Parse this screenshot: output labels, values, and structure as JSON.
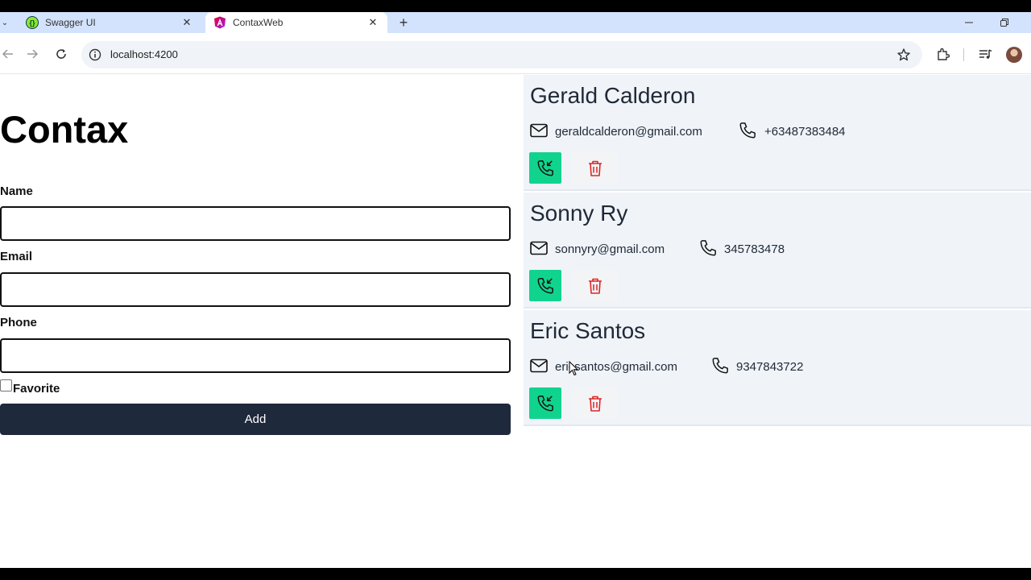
{
  "browser": {
    "tabs": [
      {
        "title": "Swagger UI",
        "favicon": "swagger-icon",
        "active": false
      },
      {
        "title": "ContaxWeb",
        "favicon": "angular-icon",
        "active": true
      }
    ],
    "address": "localhost:4200"
  },
  "app": {
    "title": "Contax",
    "form": {
      "name_label": "Name",
      "name_value": "",
      "email_label": "Email",
      "email_value": "",
      "phone_label": "Phone",
      "phone_value": "",
      "favorite_label": "Favorite",
      "favorite_checked": false,
      "add_button": "Add"
    },
    "contacts": [
      {
        "name": "Gerald Calderon",
        "email": "geraldcalderon@gmail.com",
        "phone": "+63487383484"
      },
      {
        "name": "Sonny Ry",
        "email": "sonnyry@gmail.com",
        "phone": "345783478"
      },
      {
        "name": "Eric Santos",
        "email": "ericsantos@gmail.com",
        "phone": "9347843722"
      }
    ]
  },
  "colors": {
    "call_button": "#10d48e",
    "delete_icon": "#dc2626",
    "add_button": "#1e293b",
    "contact_card_bg": "#f0f4f8"
  }
}
